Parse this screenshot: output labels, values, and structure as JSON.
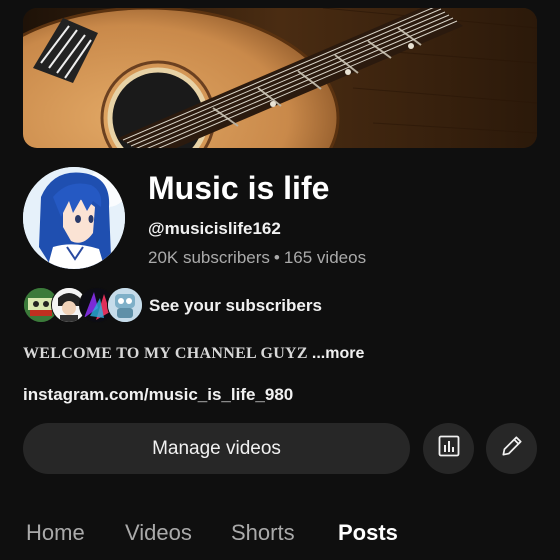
{
  "channel": {
    "title": "Music is life",
    "handle": "@musicislife162",
    "subscribers": "20K subscribers",
    "separator": "•",
    "videos": "165 videos"
  },
  "subscribers_row": {
    "label": "See your subscribers"
  },
  "description": {
    "text": "WELCOME TO MY CHANNEL GUYZ",
    "more": "...more"
  },
  "link": "instagram.com/music_is_life_980",
  "actions": {
    "manage_label": "Manage videos",
    "analytics_icon": "bar-chart-icon",
    "edit_icon": "pencil-icon"
  },
  "tabs": [
    {
      "label": "Home",
      "active": false
    },
    {
      "label": "Videos",
      "active": false
    },
    {
      "label": "Shorts",
      "active": false
    },
    {
      "label": "Posts",
      "active": true
    }
  ],
  "colors": {
    "background": "#0f0f0f",
    "button": "#272727",
    "text": "#f1f1f1",
    "secondary_text": "#aaaaaa"
  }
}
